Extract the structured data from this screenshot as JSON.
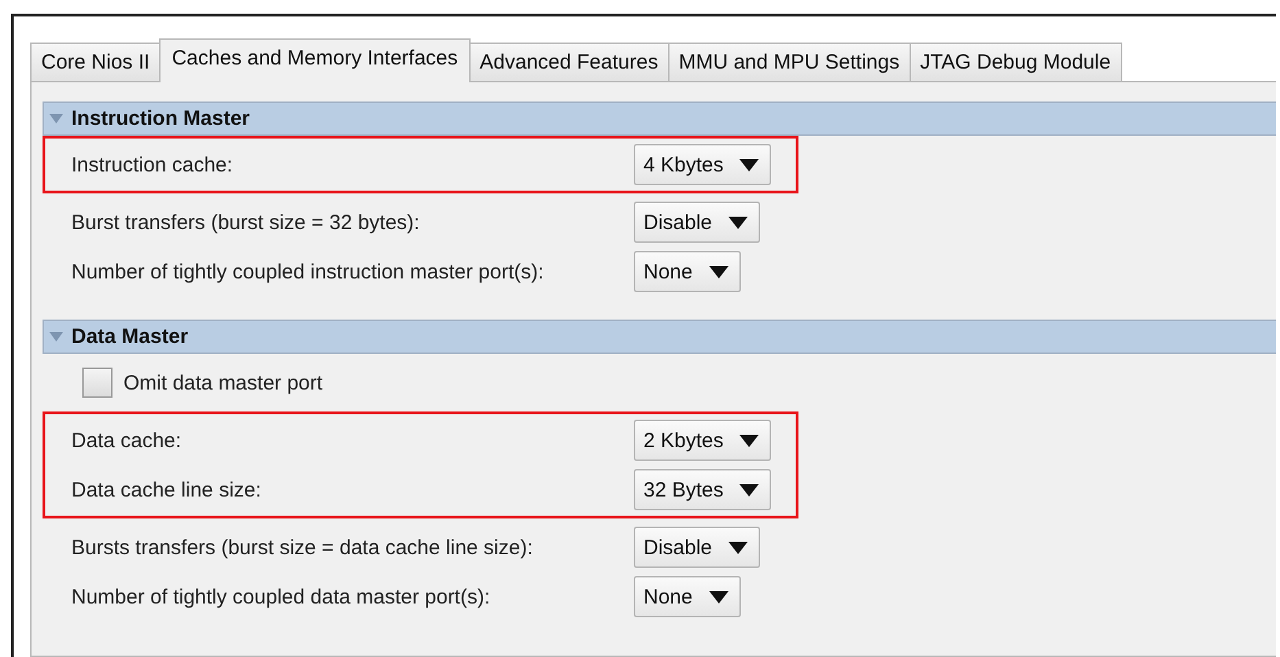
{
  "tabs": [
    {
      "label": "Core Nios II",
      "selected": false
    },
    {
      "label": "Caches and Memory Interfaces",
      "selected": true
    },
    {
      "label": "Advanced Features",
      "selected": false
    },
    {
      "label": "MMU and MPU Settings",
      "selected": false
    },
    {
      "label": "JTAG Debug Module",
      "selected": false
    }
  ],
  "sections": [
    {
      "title": "Instruction Master",
      "expanded": true,
      "groups": [
        {
          "highlighted": true,
          "rows": [
            {
              "kind": "select",
              "label": "Instruction cache:",
              "value": "4 Kbytes"
            }
          ]
        },
        {
          "highlighted": false,
          "rows": [
            {
              "kind": "select",
              "label": "Burst transfers (burst size = 32 bytes):",
              "value": "Disable"
            },
            {
              "kind": "select",
              "label": "Number of tightly coupled instruction master port(s):",
              "value": "None"
            }
          ]
        }
      ]
    },
    {
      "title": "Data Master",
      "expanded": true,
      "groups": [
        {
          "highlighted": false,
          "rows": [
            {
              "kind": "checkbox",
              "label": "Omit data master port",
              "checked": false
            }
          ]
        },
        {
          "highlighted": true,
          "rows": [
            {
              "kind": "select",
              "label": "Data cache:",
              "value": "2 Kbytes"
            },
            {
              "kind": "select",
              "label": "Data cache line size:",
              "value": "32 Bytes"
            }
          ]
        },
        {
          "highlighted": false,
          "rows": [
            {
              "kind": "select",
              "label": "Bursts transfers (burst size = data cache line size):",
              "value": "Disable"
            },
            {
              "kind": "select",
              "label": "Number of tightly coupled data master port(s):",
              "value": "None"
            }
          ]
        }
      ]
    }
  ]
}
